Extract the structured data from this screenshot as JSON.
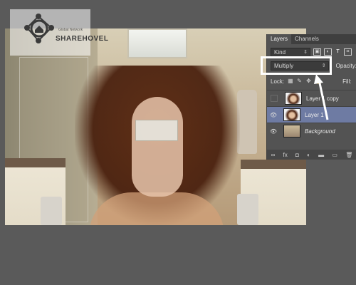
{
  "watermark": {
    "text": "SHAREHOVEL",
    "subtitle": "Global Network"
  },
  "layers_panel": {
    "tabs": [
      {
        "label": "Layers",
        "active": true
      },
      {
        "label": "Channels",
        "active": false
      }
    ],
    "filter": {
      "label": "Kind"
    },
    "blend_mode": {
      "value": "Multiply"
    },
    "opacity_label": "Opacity:",
    "lock_label": "Lock:",
    "fill_label": "Fill:",
    "layers": [
      {
        "name": "Layer 1 copy",
        "visible": false,
        "selected": false,
        "italic": false
      },
      {
        "name": "Layer 1",
        "visible": true,
        "selected": true,
        "italic": false
      },
      {
        "name": "Background",
        "visible": true,
        "selected": false,
        "italic": true
      }
    ],
    "bottom_icons": [
      "link-icon",
      "fx-icon",
      "mask-icon",
      "adjustment-icon",
      "group-icon",
      "new-layer-icon",
      "trash-icon"
    ],
    "bottom_glyphs": [
      "∞",
      "fx",
      "◘",
      "◐",
      "▬",
      "▭",
      "🗑"
    ]
  },
  "colors": {
    "panel_bg": "#535353",
    "selected_layer": "#6e7ba3",
    "highlight": "#ffffff"
  }
}
